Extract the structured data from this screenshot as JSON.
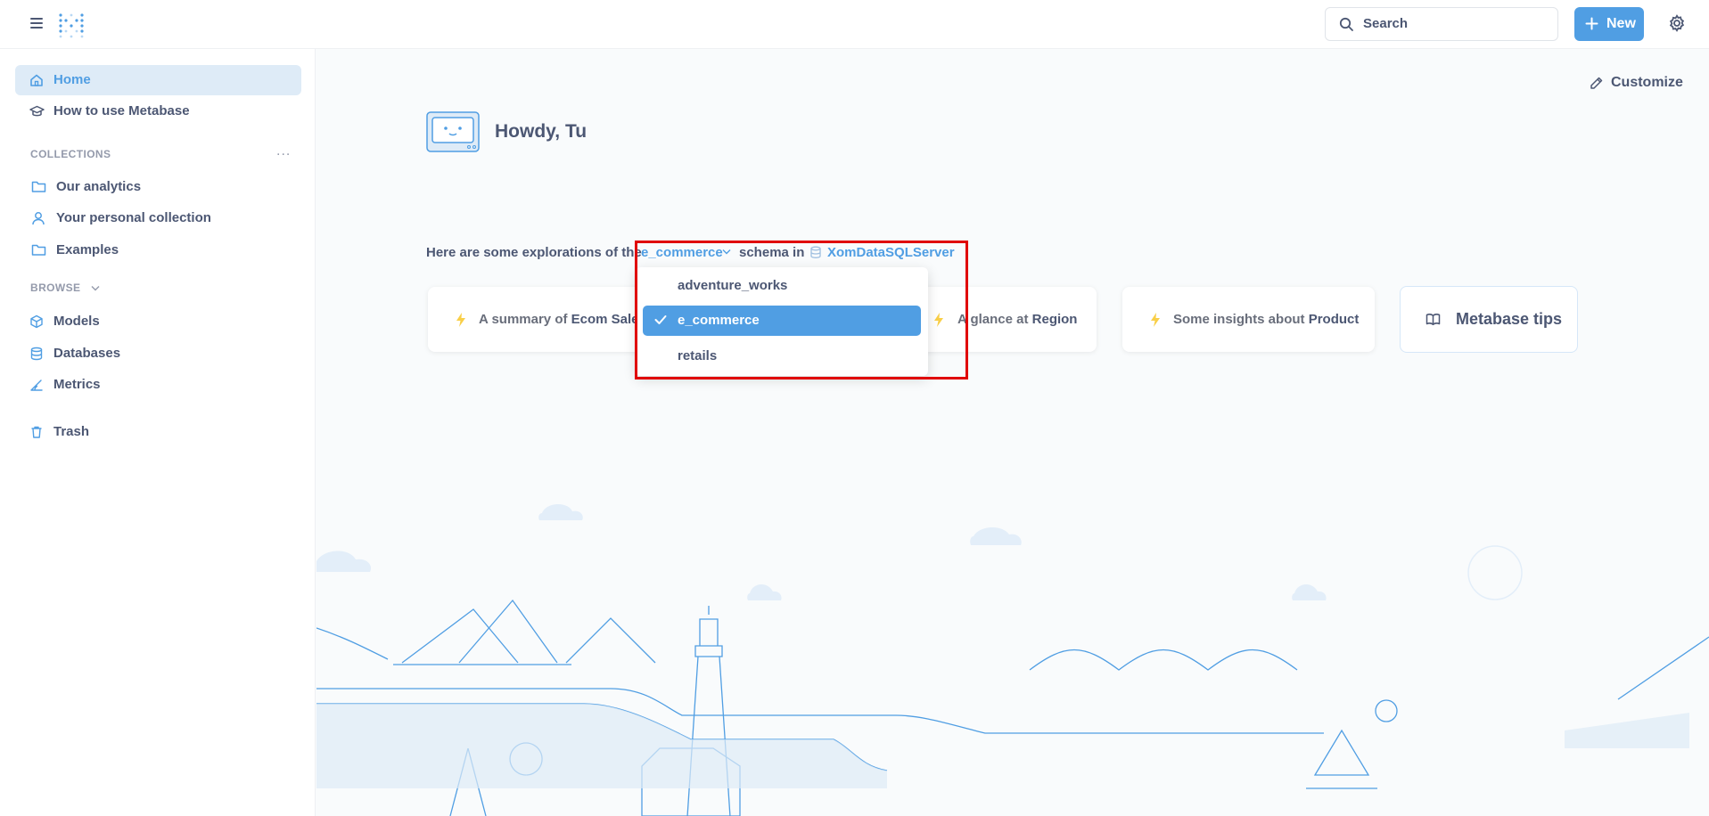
{
  "header": {
    "menu_icon": "hamburger-icon",
    "logo_icon": "metabase-logo-icon",
    "search_placeholder": "Search",
    "new_label": "New",
    "settings_icon": "gear-icon"
  },
  "sidebar": {
    "home_label": "Home",
    "how_to_label": "How to use Metabase",
    "collections_title": "COLLECTIONS",
    "collections_more": "...",
    "collections": [
      {
        "label": "Our analytics",
        "icon": "folder-icon"
      },
      {
        "label": "Your personal collection",
        "icon": "person-icon"
      },
      {
        "label": "Examples",
        "icon": "folder-icon"
      }
    ],
    "browse_title": "BROWSE",
    "browse": [
      {
        "label": "Models",
        "icon": "cube-icon"
      },
      {
        "label": "Databases",
        "icon": "database-icon"
      },
      {
        "label": "Metrics",
        "icon": "metric-icon"
      }
    ],
    "trash_label": "Trash"
  },
  "main": {
    "customize_label": "Customize",
    "greeting": "Howdy, Tu",
    "explore_prefix": "Here are some explorations of the",
    "schema_value": "e_commerce",
    "schema_in": "schema in",
    "database_name": "XomDataSQLServer",
    "cards": [
      {
        "prefix": "A summary of ",
        "subject": "Ecom Sales"
      },
      {
        "prefix": "A glance at ",
        "subject": "Region"
      },
      {
        "prefix": "Some insights about ",
        "subject": "Product"
      }
    ],
    "tips_label": "Metabase tips"
  },
  "dropdown": {
    "options": [
      "adventure_works",
      "e_commerce",
      "retails"
    ],
    "selected": "e_commerce"
  },
  "colors": {
    "brand": "#509ee3",
    "highlight": "#e00000",
    "bolt": "#f9cf48"
  }
}
